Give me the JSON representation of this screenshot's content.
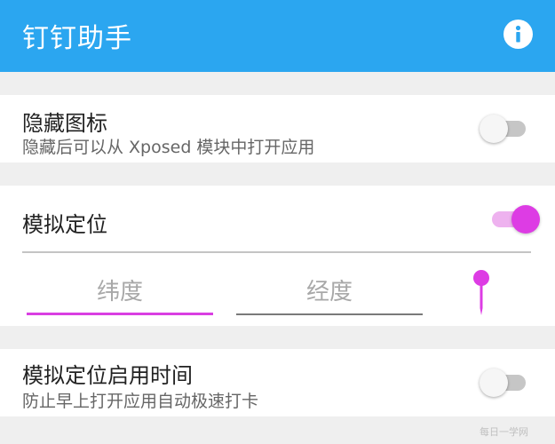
{
  "app_bar": {
    "title": "钉钉助手",
    "info_icon": "info-icon",
    "color": "#2ba6f0"
  },
  "hide_icon": {
    "title": "隐藏图标",
    "subtitle": "隐藏后可以从 Xposed 模块中打开应用",
    "enabled": false
  },
  "mock_location": {
    "title": "模拟定位",
    "enabled": true,
    "accent_color": "#dd3ce4",
    "latitude": {
      "value": "",
      "placeholder": "纬度"
    },
    "longitude": {
      "value": "",
      "placeholder": "经度"
    },
    "pin_icon": "map-pin-icon"
  },
  "mock_time": {
    "title": "模拟定位启用时间",
    "subtitle": "防止早上打开应用自动极速打卡",
    "enabled": false
  },
  "watermark": "每日一学网"
}
